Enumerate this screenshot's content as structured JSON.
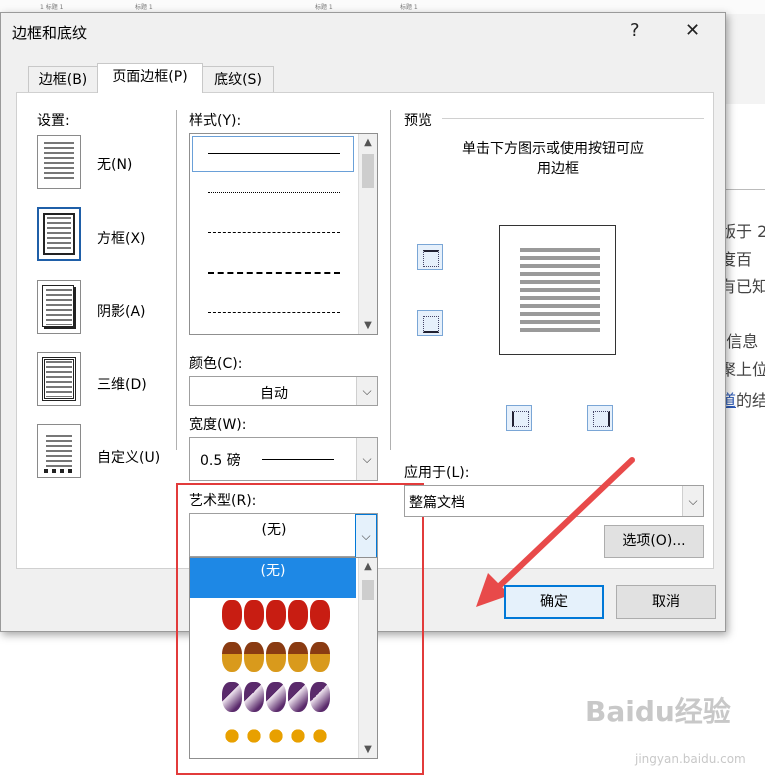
{
  "background": {
    "doc_heading_1": "1 标题 1",
    "doc_heading_2": "标题 1",
    "doc_heading_3": "标题 1",
    "doc_heading_4": "标题 1",
    "doc_lines": [
      "版于 2",
      "度百",
      "有已知",
      "",
      "(信息",
      "聚上位",
      "道的结"
    ],
    "doc_link_text": "道",
    "watermark": "Baidu经验",
    "watermark_sub": "jingyan.baidu.com"
  },
  "dialog": {
    "title": "边框和底纹",
    "help_label": "?",
    "close_label": "✕",
    "tabs": [
      {
        "label": "边框(B)",
        "active": false
      },
      {
        "label": "页面边框(P)",
        "active": true
      },
      {
        "label": "底纹(S)",
        "active": false
      }
    ],
    "settings": {
      "label": "设置:",
      "items": [
        {
          "label": "无(N)"
        },
        {
          "label": "方框(X)"
        },
        {
          "label": "阴影(A)"
        },
        {
          "label": "三维(D)"
        },
        {
          "label": "自定义(U)"
        }
      ]
    },
    "style": {
      "label": "样式(Y):",
      "selected_index": 0
    },
    "color": {
      "label": "颜色(C):",
      "value": "自动"
    },
    "width": {
      "label": "宽度(W):",
      "value": "0.5 磅"
    },
    "art": {
      "label": "艺术型(R):",
      "value": "(无)",
      "list_first": "(无)"
    },
    "preview": {
      "label": "预览",
      "hint_line1": "单击下方图示或使用按钮可应",
      "hint_line2": "用边框"
    },
    "apply_to": {
      "label": "应用于(L):",
      "value": "整篇文档"
    },
    "options_button": "选项(O)...",
    "ok_button": "确定",
    "cancel_button": "取消"
  },
  "colors": {
    "accent": "#0078d7",
    "highlight": "#e23b3b",
    "selected_item": "#1e88e5"
  }
}
